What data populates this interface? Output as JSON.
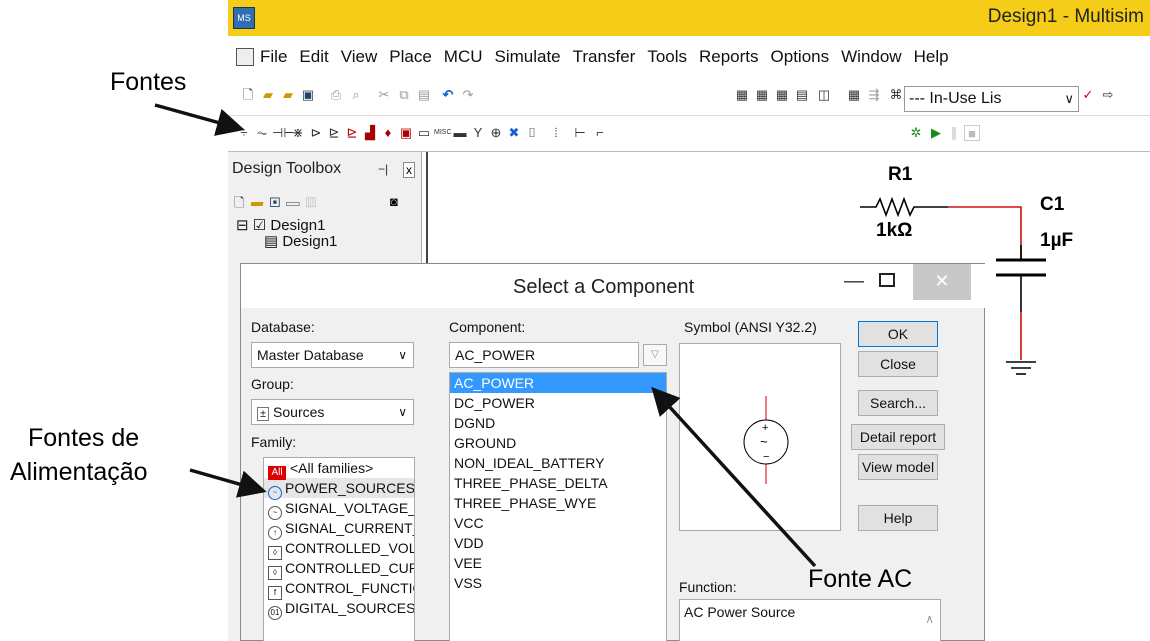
{
  "window": {
    "title": "Design1 - Multisim"
  },
  "menu": [
    "File",
    "Edit",
    "View",
    "Place",
    "MCU",
    "Simulate",
    "Transfer",
    "Tools",
    "Reports",
    "Options",
    "Window",
    "Help"
  ],
  "toolbar": {
    "inuse_label": "--- In-Use Lis"
  },
  "design_toolbox": {
    "title": "Design Toolbox",
    "close": "x",
    "tree": [
      "Design1",
      "Design1"
    ]
  },
  "schematic": {
    "r1_name": "R1",
    "r1_value": "1kΩ",
    "c1_name": "C1",
    "c1_value": "1µF",
    "wire_color": "#d01010"
  },
  "dialog": {
    "title": "Select a Component",
    "database_label": "Database:",
    "database_value": "Master Database",
    "group_label": "Group:",
    "group_value": "Sources",
    "family_label": "Family:",
    "families": [
      "<All families>",
      "POWER_SOURCES",
      "SIGNAL_VOLTAGE_S",
      "SIGNAL_CURRENT_S",
      "CONTROLLED_VOLT",
      "CONTROLLED_CURR",
      "CONTROL_FUNCTIO",
      "DIGITAL_SOURCES"
    ],
    "family_all_icon": "All",
    "component_label": "Component:",
    "component_value": "AC_POWER",
    "components": [
      "AC_POWER",
      "DC_POWER",
      "DGND",
      "GROUND",
      "NON_IDEAL_BATTERY",
      "THREE_PHASE_DELTA",
      "THREE_PHASE_WYE",
      "VCC",
      "VDD",
      "VEE",
      "VSS"
    ],
    "symbol_label": "Symbol (ANSI Y32.2)",
    "function_label": "Function:",
    "function_value": "AC Power Source",
    "buttons": {
      "ok": "OK",
      "close": "Close",
      "search": "Search...",
      "detail": "Detail report",
      "view_model": "View model",
      "help": "Help"
    }
  },
  "annotations": {
    "fontes": "Fontes",
    "fontes_alimentacao_1": "Fontes de",
    "fontes_alimentacao_2": "Alimentação",
    "fonte_ac": "Fonte AC"
  }
}
